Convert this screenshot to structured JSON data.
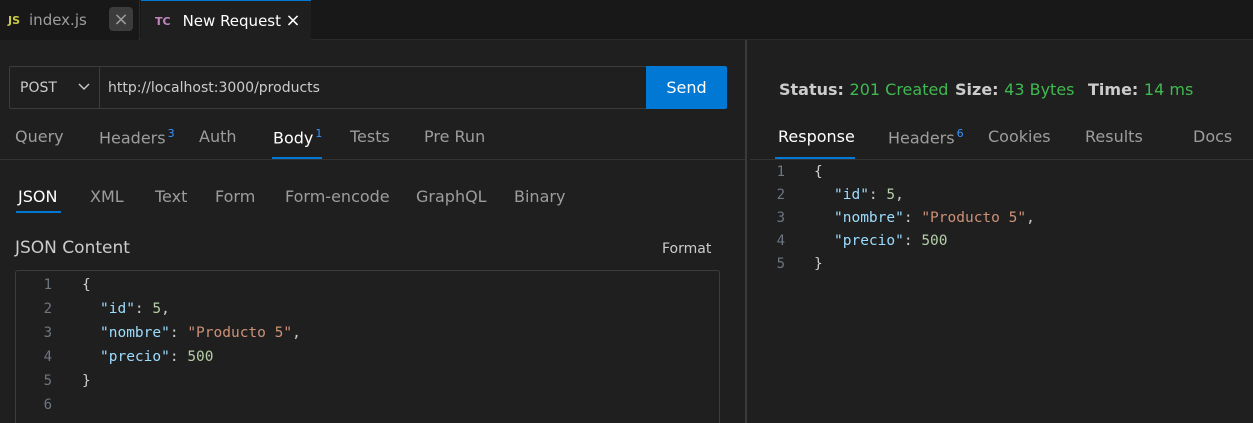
{
  "tabs": [
    {
      "icon": "JS",
      "label": "index.js",
      "active": false
    },
    {
      "icon": "TC",
      "label": "New Request",
      "active": true
    }
  ],
  "request": {
    "method": "POST",
    "url": "http://localhost:3000/products",
    "send_label": "Send",
    "tabs": [
      {
        "label": "Query"
      },
      {
        "label": "Headers",
        "badge": "3"
      },
      {
        "label": "Auth"
      },
      {
        "label": "Body",
        "badge": "1",
        "active": true
      },
      {
        "label": "Tests"
      },
      {
        "label": "Pre Run"
      }
    ],
    "body_tabs": [
      "JSON",
      "XML",
      "Text",
      "Form",
      "Form-encode",
      "GraphQL",
      "Binary"
    ],
    "content_title": "JSON Content",
    "format_label": "Format",
    "line_numbers": [
      "1",
      "2",
      "3",
      "4",
      "5",
      "6"
    ],
    "code": {
      "open": "{",
      "id_key": "\"id\"",
      "id_val": "5",
      "nombre_key": "\"nombre\"",
      "nombre_val": "\"Producto 5\"",
      "precio_key": "\"precio\"",
      "precio_val": "500",
      "close": "}"
    }
  },
  "response": {
    "status_label": "Status:",
    "status_value": "201 Created",
    "size_label": "Size:",
    "size_value": "43 Bytes",
    "time_label": "Time:",
    "time_value": "14 ms",
    "tabs": [
      {
        "label": "Response",
        "active": true
      },
      {
        "label": "Headers",
        "badge": "6"
      },
      {
        "label": "Cookies"
      },
      {
        "label": "Results"
      },
      {
        "label": "Docs"
      }
    ],
    "line_numbers": [
      "1",
      "2",
      "3",
      "4",
      "5"
    ],
    "code": {
      "open": "{",
      "id_key": "\"id\"",
      "id_val": "5",
      "nombre_key": "\"nombre\"",
      "nombre_val": "\"Producto 5\"",
      "precio_key": "\"precio\"",
      "precio_val": "500",
      "close": "}"
    }
  },
  "colors": {
    "accent": "#0078d4",
    "status_ok": "#3fb950",
    "badge": "#3794ff",
    "json_key": "#9cdcfe",
    "json_string": "#ce9178",
    "json_number": "#b5cea8"
  }
}
